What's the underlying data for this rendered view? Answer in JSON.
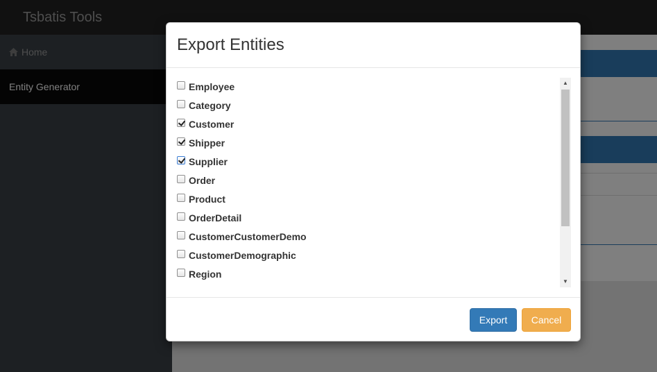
{
  "app": {
    "brand": "Tsbatis Tools"
  },
  "sidebar": {
    "items": [
      {
        "label": "Home",
        "icon": "home-icon"
      },
      {
        "label": "Entity Generator",
        "active": true
      }
    ]
  },
  "modal": {
    "title": "Export Entities",
    "entities": [
      {
        "label": "Employee",
        "checked": false
      },
      {
        "label": "Category",
        "checked": false
      },
      {
        "label": "Customer",
        "checked": true
      },
      {
        "label": "Shipper",
        "checked": true
      },
      {
        "label": "Supplier",
        "checked": true
      },
      {
        "label": "Order",
        "checked": false
      },
      {
        "label": "Product",
        "checked": false
      },
      {
        "label": "OrderDetail",
        "checked": false
      },
      {
        "label": "CustomerCustomerDemo",
        "checked": false
      },
      {
        "label": "CustomerDemographic",
        "checked": false
      },
      {
        "label": "Region",
        "checked": false
      }
    ],
    "export_label": "Export",
    "cancel_label": "Cancel"
  },
  "colors": {
    "primary": "#337ab7",
    "warning": "#f0ad4e",
    "navbar": "#222222",
    "sidebar": "#3a4147"
  }
}
